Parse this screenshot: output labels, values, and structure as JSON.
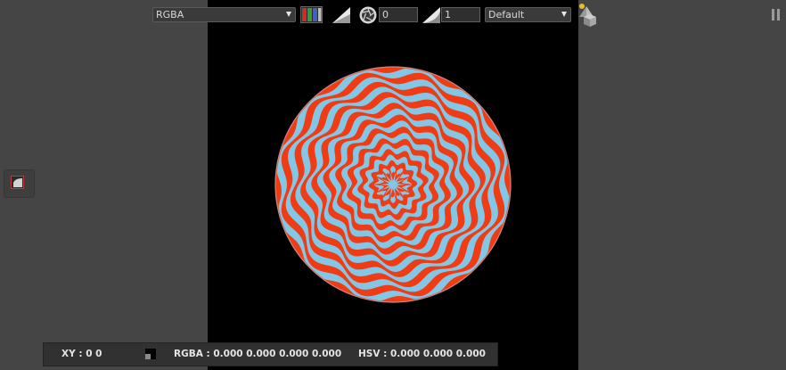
{
  "toolbar": {
    "channel_select": "RGBA",
    "gain_value": "0",
    "gamma_value": "1",
    "lut_select": "Default"
  },
  "icons": {
    "channels": "rgb-channels-icon",
    "gain_ramp": "gain-ramp-icon",
    "exposure": "aperture-icon",
    "gamma_ramp": "gamma-ramp-icon",
    "shapes": "3d-shapes-icon",
    "side_tool": "curve-tool-icon",
    "pause": "pause-icon"
  },
  "colors": {
    "pattern_red": "#f03c14",
    "pattern_blue": "#82c8e6",
    "background": "#454545",
    "canvas": "#000000"
  },
  "status": {
    "xy": "XY : 0 0",
    "rgba": "RGBA : 0.000 0.000 0.000 0.000",
    "hsv": "HSV : 0.000 0.000 0.000"
  }
}
